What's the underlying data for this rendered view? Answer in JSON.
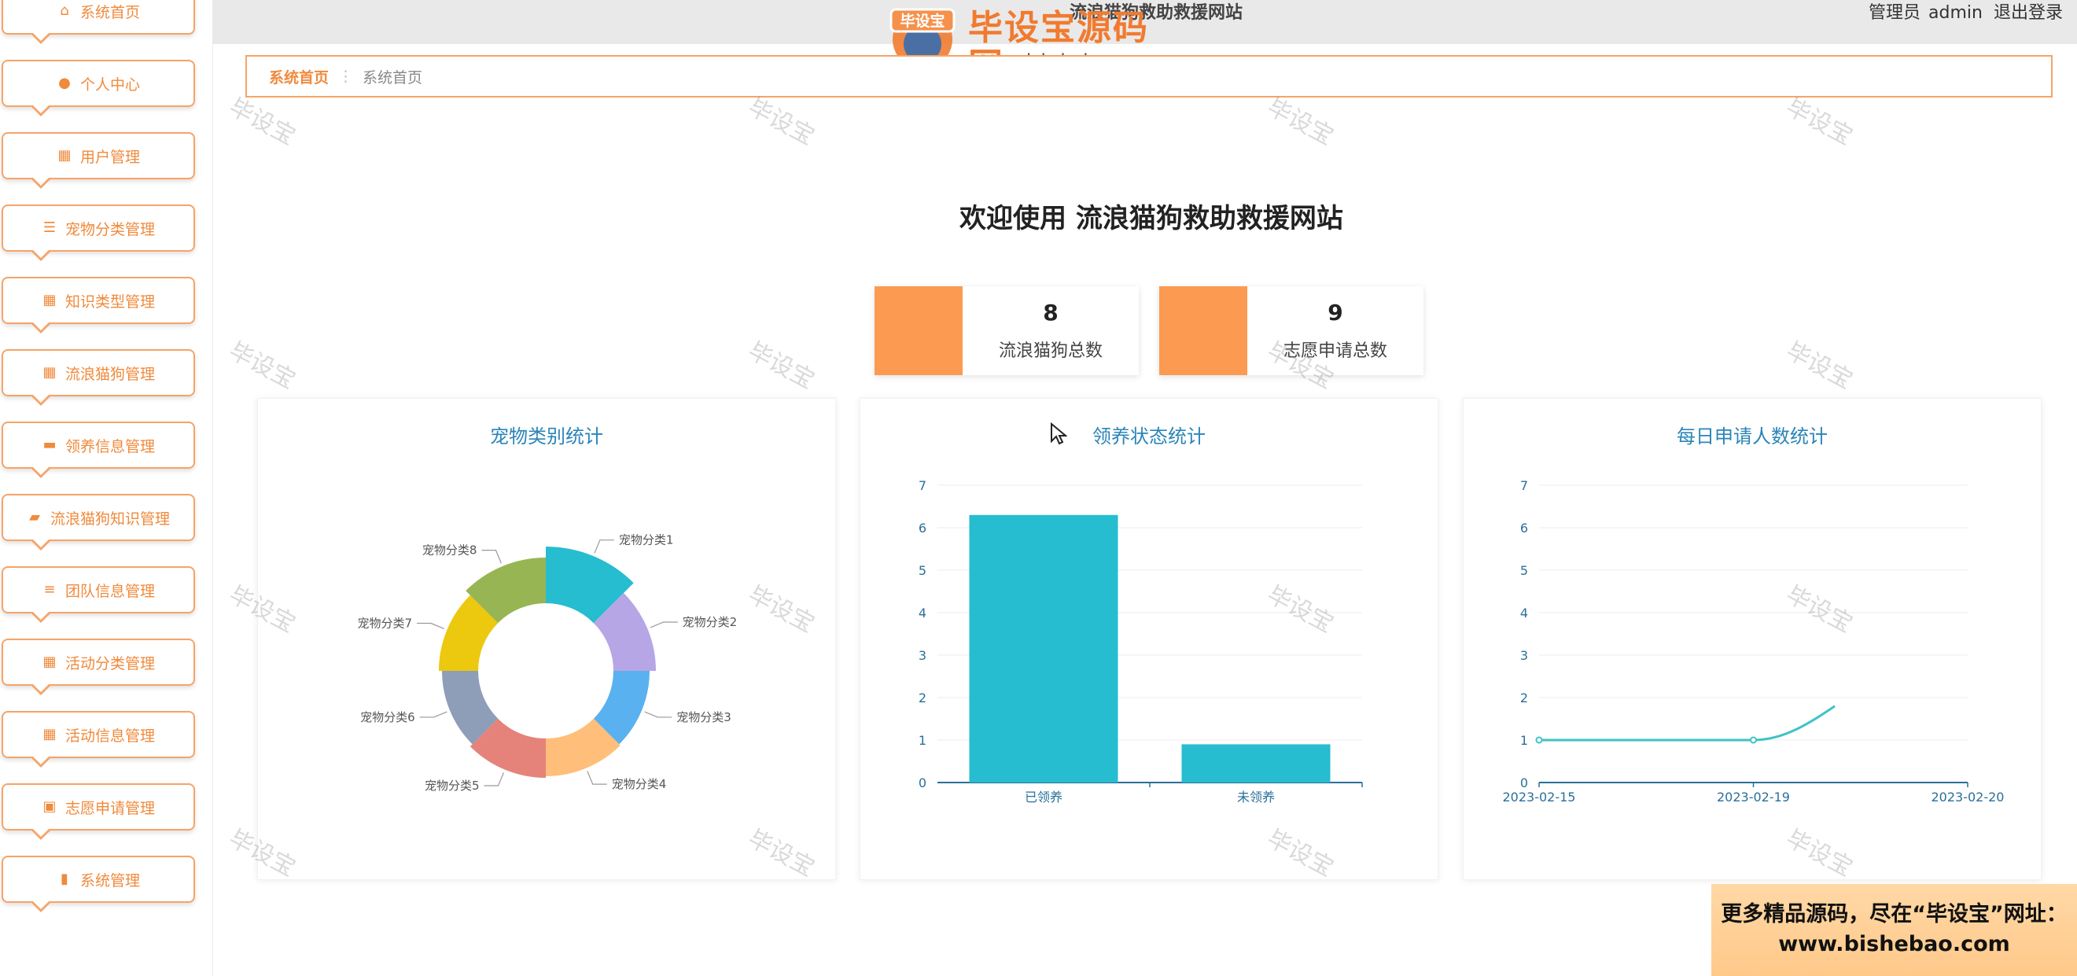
{
  "sidebar": {
    "items": [
      {
        "label": "系统首页",
        "icon": "home-icon"
      },
      {
        "label": "个人中心",
        "icon": "user-icon"
      },
      {
        "label": "用户管理",
        "icon": "grid-icon"
      },
      {
        "label": "宠物分类管理",
        "icon": "list-icon"
      },
      {
        "label": "知识类型管理",
        "icon": "grid-icon"
      },
      {
        "label": "流浪猫狗管理",
        "icon": "grid-icon"
      },
      {
        "label": "领养信息管理",
        "icon": "ticket-icon"
      },
      {
        "label": "流浪猫狗知识管理",
        "icon": "folder-icon"
      },
      {
        "label": "团队信息管理",
        "icon": "sliders-icon"
      },
      {
        "label": "活动分类管理",
        "icon": "grid-icon"
      },
      {
        "label": "活动信息管理",
        "icon": "grid-icon"
      },
      {
        "label": "志愿申请管理",
        "icon": "clipboard-icon"
      },
      {
        "label": "系统管理",
        "icon": "bar-chart-icon"
      }
    ]
  },
  "header": {
    "title": "流浪猫狗救助救援网站",
    "user_role": "管理员",
    "username": "admin",
    "logout": "退出登录"
  },
  "logo": {
    "badge": "毕设宝",
    "text": "毕设宝源码网",
    "url": "www.bishebao.com"
  },
  "breadcrumb": {
    "home": "系统首页",
    "separator": "⋮",
    "current": "系统首页"
  },
  "welcome": {
    "prefix": "欢迎使用",
    "site_name": "流浪猫狗救助救援网站"
  },
  "stats": [
    {
      "value": "8",
      "label": "流浪猫狗总数"
    },
    {
      "value": "9",
      "label": "志愿申请总数"
    }
  ],
  "watermark": "毕设宝",
  "ad": {
    "line1": "更多精品源码，尽在“毕设宝”网址：",
    "line2": "www.bishebao.com"
  },
  "colors": {
    "accent": "#f6a468",
    "stat": "#fc9a52",
    "bar": "#25bdcf",
    "title": "#2a85b8"
  },
  "chart_data": [
    {
      "type": "pie",
      "title": "宠物类别统计",
      "slices": [
        {
          "name": "宠物分类1",
          "value": 1,
          "color": "#25bdcf"
        },
        {
          "name": "宠物分类2",
          "value": 1,
          "color": "#b7a6e6"
        },
        {
          "name": "宠物分类3",
          "value": 1,
          "color": "#5ab1ef"
        },
        {
          "name": "宠物分类4",
          "value": 1,
          "color": "#ffbe7a"
        },
        {
          "name": "宠物分类5",
          "value": 1,
          "color": "#e5837b"
        },
        {
          "name": "宠物分类6",
          "value": 1,
          "color": "#8e9db8"
        },
        {
          "name": "宠物分类7",
          "value": 1,
          "color": "#ecc80f"
        },
        {
          "name": "宠物分类8",
          "value": 1,
          "color": "#97b552"
        }
      ]
    },
    {
      "type": "bar",
      "title": "领养状态统计",
      "categories": [
        "已领养",
        "未领养"
      ],
      "values": [
        6.3,
        0.9
      ],
      "ylim": [
        0,
        7
      ],
      "yticks": [
        "0",
        "1",
        "2",
        "3",
        "4",
        "5",
        "6",
        "7"
      ]
    },
    {
      "type": "line",
      "title": "每日申请人数统计",
      "x": [
        "2023-02-15",
        "2023-02-19",
        "2023-02-20"
      ],
      "points": [
        {
          "x": "2023-02-15",
          "y": 1
        },
        {
          "x": "2023-02-19",
          "y": 1
        },
        {
          "x": "2023-02-20",
          "y": 1.8
        }
      ],
      "ylim": [
        0,
        7
      ],
      "yticks": [
        "0",
        "1",
        "2",
        "3",
        "4",
        "5",
        "6",
        "7"
      ]
    }
  ]
}
